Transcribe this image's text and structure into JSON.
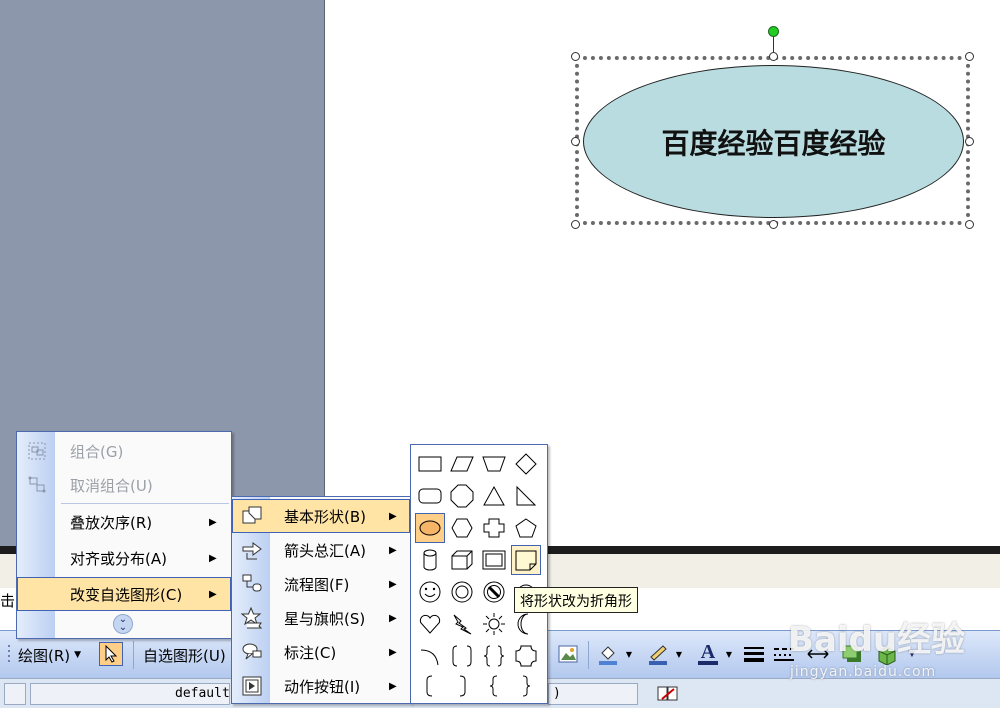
{
  "canvas": {
    "shape_text": "百度经验百度经验",
    "shape_fill": "#b8dcdf"
  },
  "partial_text": "击",
  "context_menu": {
    "items": [
      {
        "label": "组合(G)",
        "enabled": false,
        "icon": "group-icon"
      },
      {
        "label": "取消组合(U)",
        "enabled": false,
        "icon": "ungroup-icon"
      },
      {
        "label": "叠放次序(R)",
        "enabled": true,
        "submenu": true
      },
      {
        "label": "对齐或分布(A)",
        "enabled": true,
        "submenu": true
      },
      {
        "label": "改变自选图形(C)",
        "enabled": true,
        "submenu": true,
        "highlighted": true
      }
    ],
    "expand_icon": "double-chevron-down-icon"
  },
  "submenu": {
    "items": [
      {
        "label": "基本形状(B)",
        "icon": "basic-shapes-icon",
        "highlighted": true
      },
      {
        "label": "箭头总汇(A)",
        "icon": "block-arrows-icon"
      },
      {
        "label": "流程图(F)",
        "icon": "flowchart-icon"
      },
      {
        "label": "星与旗帜(S)",
        "icon": "stars-banners-icon"
      },
      {
        "label": "标注(C)",
        "icon": "callouts-icon"
      },
      {
        "label": "动作按钮(I)",
        "icon": "action-buttons-icon"
      }
    ]
  },
  "shape_palette": {
    "rows": [
      [
        "rectangle",
        "parallelogram",
        "trapezoid",
        "diamond"
      ],
      [
        "rounded-rectangle",
        "octagon",
        "isosceles-triangle",
        "right-triangle"
      ],
      [
        "oval",
        "hexagon",
        "cross",
        "pentagon"
      ],
      [
        "can",
        "cube",
        "bevel",
        "folded-corner"
      ],
      [
        "smiley-face",
        "donut",
        "no-symbol",
        "block-arc"
      ],
      [
        "heart",
        "lightning-bolt",
        "sun",
        "moon"
      ],
      [
        "arc",
        "double-bracket",
        "double-brace",
        "plaque"
      ],
      [
        "left-bracket",
        "right-bracket",
        "left-brace",
        "right-brace"
      ]
    ],
    "selected": "oval",
    "hovered": "folded-corner"
  },
  "tooltip": "将形状改为折角形",
  "toolbar": {
    "draw_label": "绘图(R)",
    "autoshapes_label": "自选图形(U)",
    "font_color_letter": "A"
  },
  "statusbar": {
    "style_text": "default",
    "paren_text": ")"
  },
  "watermark": {
    "brand": "Baidu经验",
    "url": "jingyan.baidu.com"
  }
}
